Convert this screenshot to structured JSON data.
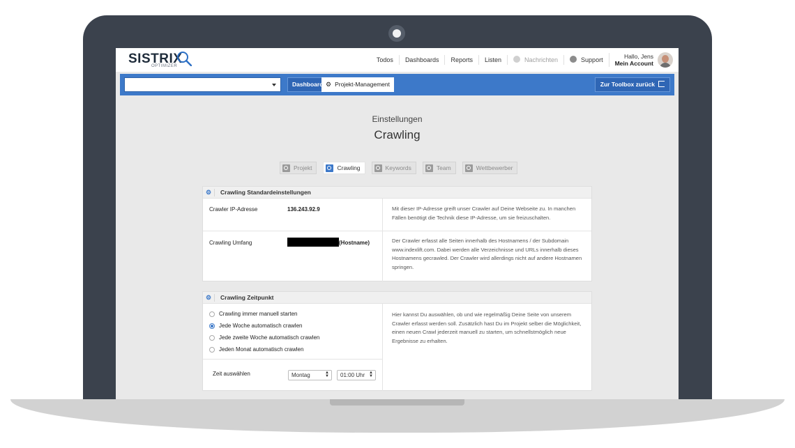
{
  "logo": {
    "name": "SISTRIX",
    "sub": "OPTIMIZER"
  },
  "topnav": {
    "items": [
      "Todos",
      "Dashboards",
      "Reports",
      "Listen"
    ],
    "messages": "Nachrichten",
    "support": "Support",
    "user_hello": "Hallo, Jens",
    "user_account": "Mein Account"
  },
  "bluebar": {
    "project_select": "",
    "dashboard": "Dashboard",
    "project_management": "Projekt-Management",
    "back": "Zur Toolbox zurück"
  },
  "page": {
    "subtitle": "Einstellungen",
    "title": "Crawling"
  },
  "tabs": [
    "Projekt",
    "Crawling",
    "Keywords",
    "Team",
    "Wettbewerber"
  ],
  "active_tab": "Crawling",
  "defaults_panel": {
    "title": "Crawling Standardeinstellungen",
    "ip_label": "Crawler IP-Adresse",
    "ip_value": "136.243.92.9",
    "ip_desc": "Mit dieser IP-Adresse greift unser Crawler auf Deine Webseite zu. In manchen Fällen benötigt die Technik diese IP-Adresse, um sie freizuschalten.",
    "scope_label": "Crawling Umfang",
    "scope_value": "(Hostname)",
    "scope_desc": "Der Crawler erfasst alle Seiten innerhalb des Hostnamens / der Subdomain www.indexlift.com. Dabei werden alle Verzeichnisse und URLs innerhalb dieses Hostnamens gecrawled. Der Crawler wird allerdings nicht auf andere Hostnamen springen."
  },
  "schedule_panel": {
    "title": "Crawling Zeitpunkt",
    "options": [
      "Crawling immer manuell starten",
      "Jede Woche automatisch crawlen",
      "Jede zweite Woche automatisch crawlen",
      "Jeden Monat automatisch crawlen"
    ],
    "selected_option": "Jede Woche automatisch crawlen",
    "time_label": "Zeit auswählen",
    "day_value": "Montag",
    "time_value": "01:00 Uhr",
    "desc": "Hier kannst Du auswählen, ob und wie regelmäßig Deine Seite von unserem Crawler erfasst werden soll. Zusätzlich hast Du im Projekt selber die Möglichkeit, einen neuen Crawl jederzeit manuell zu starten, um schnellstmöglich neue Ergebnisse zu erhalten."
  },
  "colors": {
    "brand_blue": "#3d79c9",
    "laptop_frame": "#3b424d"
  },
  "icons": [
    "search-icon",
    "bell-icon",
    "question-icon",
    "gear-icon",
    "exit-icon",
    "caret-down-icon"
  ]
}
